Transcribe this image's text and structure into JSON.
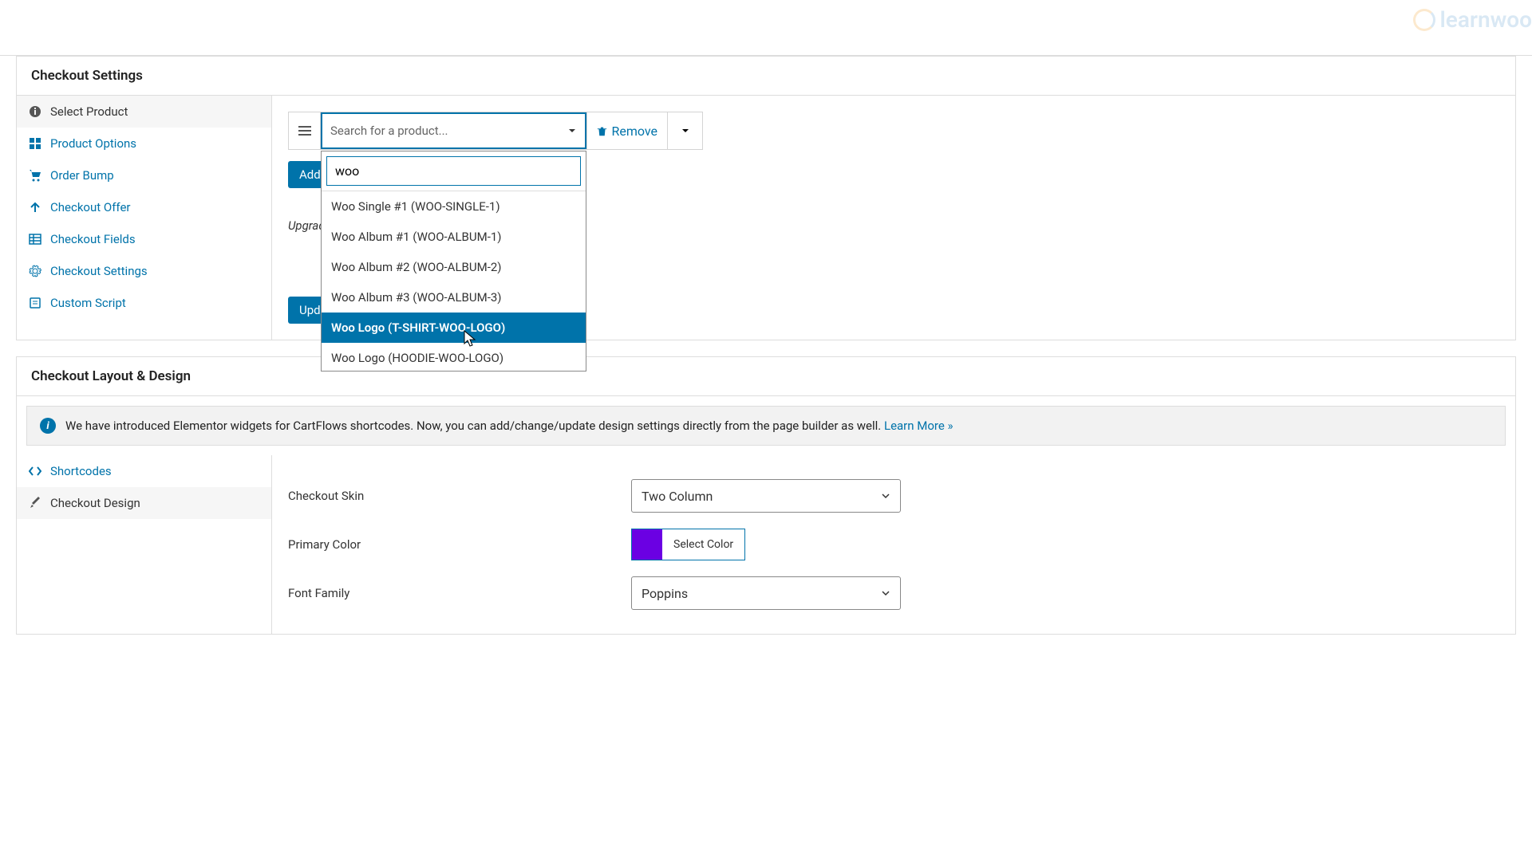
{
  "watermark": "learnwoo",
  "checkout_settings": {
    "title": "Checkout Settings",
    "tabs": [
      {
        "label": "Select Product"
      },
      {
        "label": "Product Options"
      },
      {
        "label": "Order Bump"
      },
      {
        "label": "Checkout Offer"
      },
      {
        "label": "Checkout Fields"
      },
      {
        "label": "Checkout Settings"
      },
      {
        "label": "Custom Script"
      }
    ],
    "product": {
      "placeholder": "Search for a product...",
      "remove_label": "Remove",
      "add_button": "Add N",
      "upgrade_text": "Upgrad",
      "update_button": "Upda",
      "search_value": "woo",
      "results": [
        {
          "label": "Woo Single #1 (WOO-SINGLE-1)"
        },
        {
          "label": "Woo Album #1 (WOO-ALBUM-1)"
        },
        {
          "label": "Woo Album #2 (WOO-ALBUM-2)"
        },
        {
          "label": "Woo Album #3 (WOO-ALBUM-3)"
        },
        {
          "label": "Woo Logo (T-SHIRT-WOO-LOGO)",
          "highlighted": true
        },
        {
          "label": "Woo Logo (HOODIE-WOO-LOGO)"
        }
      ]
    }
  },
  "layout": {
    "title": "Checkout Layout & Design",
    "info_text": "We have introduced Elementor widgets for CartFlows shortcodes. Now, you can add/change/update design settings directly from the page builder as well. ",
    "info_link": "Learn More »",
    "tabs": [
      {
        "label": "Shortcodes"
      },
      {
        "label": "Checkout Design"
      }
    ],
    "fields": {
      "skin_label": "Checkout Skin",
      "skin_value": "Two Column",
      "color_label": "Primary Color",
      "color_btn": "Select Color",
      "color_value": "#6b00e3",
      "font_label": "Font Family",
      "font_value": "Poppins"
    }
  }
}
